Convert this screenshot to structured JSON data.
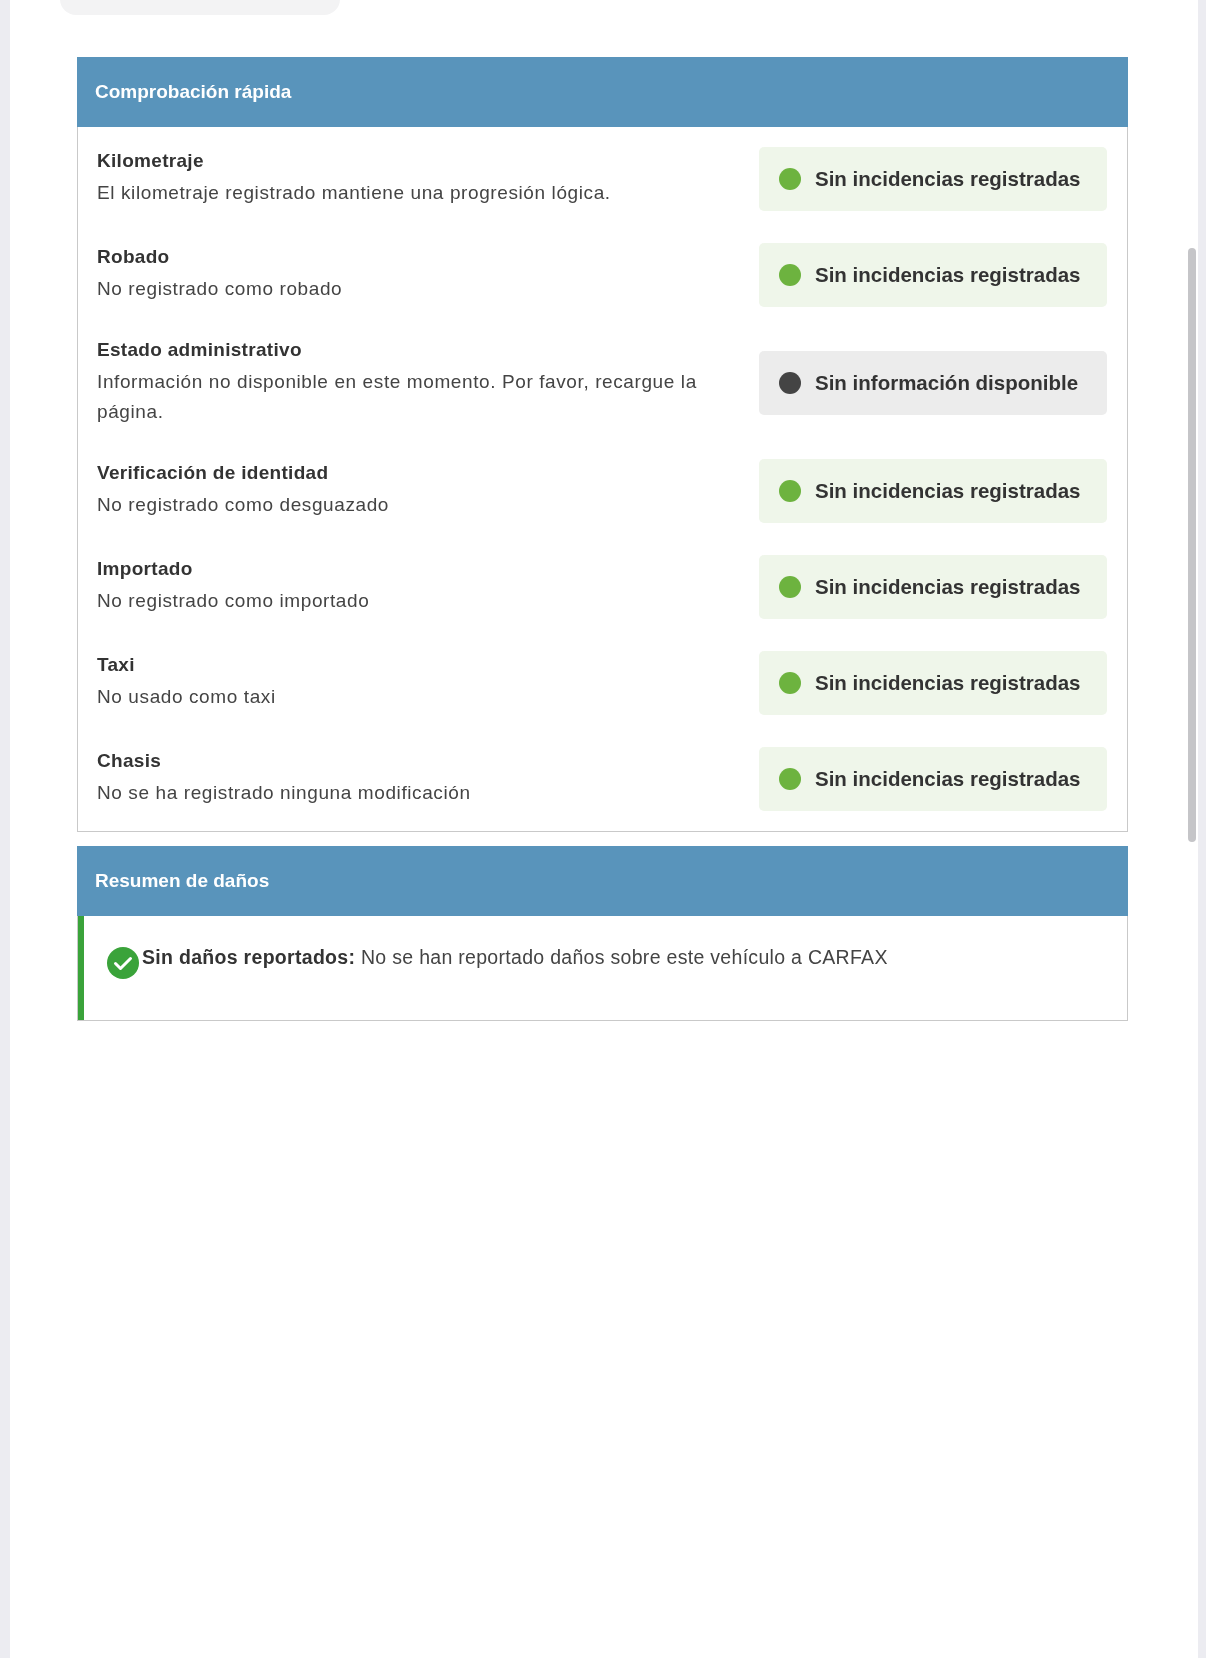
{
  "quick_check": {
    "title": "Comprobación rápida",
    "items": [
      {
        "title": "Kilometraje",
        "description": "El kilometraje registrado mantiene una progresión lógica.",
        "status": {
          "kind": "ok",
          "color": "#6db33f",
          "label": "Sin incidencias registradas"
        }
      },
      {
        "title": "Robado",
        "description": "No registrado como robado",
        "status": {
          "kind": "ok",
          "color": "#6db33f",
          "label": "Sin incidencias registradas"
        }
      },
      {
        "title": "Estado administrativo",
        "description": "Información no disponible en este momento. Por favor, recargue la página.",
        "status": {
          "kind": "none",
          "color": "#444444",
          "label": "Sin información disponible"
        }
      },
      {
        "title": "Verificación de identidad",
        "description": "No registrado como desguazado",
        "status": {
          "kind": "ok",
          "color": "#6db33f",
          "label": "Sin incidencias registradas"
        }
      },
      {
        "title": "Importado",
        "description": "No registrado como importado",
        "status": {
          "kind": "ok",
          "color": "#6db33f",
          "label": "Sin incidencias registradas"
        }
      },
      {
        "title": "Taxi",
        "description": "No usado como taxi",
        "status": {
          "kind": "ok",
          "color": "#6db33f",
          "label": "Sin incidencias registradas"
        }
      },
      {
        "title": "Chasis",
        "description": "No se ha registrado ninguna modificación",
        "status": {
          "kind": "ok",
          "color": "#6db33f",
          "label": "Sin incidencias registradas"
        }
      }
    ]
  },
  "damage_summary": {
    "title": "Resumen de daños",
    "message": "**Sin daños reportados:** No se han reportado daños sobre este vehículo a CARFAX"
  }
}
